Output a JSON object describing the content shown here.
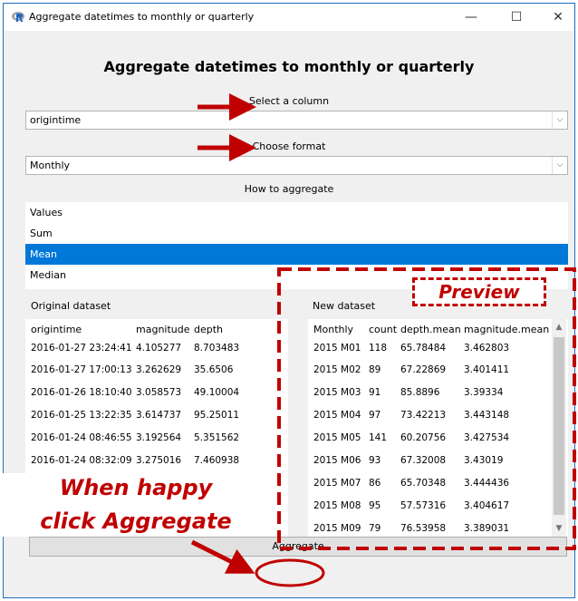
{
  "window": {
    "title": "Aggregate datetimes to monthly or quarterly",
    "min_symbol": "—",
    "max_symbol": "☐",
    "close_symbol": "✕"
  },
  "heading": "Aggregate datetimes to monthly or quarterly",
  "column_select": {
    "label": "Select a column",
    "value": "origintime"
  },
  "format_select": {
    "label": "Choose format",
    "value": "Monthly"
  },
  "aggregate_list": {
    "label": "How to aggregate",
    "items": [
      "Values",
      "Sum",
      "Mean",
      "Median"
    ],
    "selected": "Mean"
  },
  "original": {
    "title": "Original dataset",
    "columns": [
      "origintime",
      "magnitude",
      "depth"
    ],
    "rows": [
      [
        "2016-01-27 23:24:41",
        "4.105277",
        "8.703483"
      ],
      [
        "2016-01-27 17:00:13",
        "3.262629",
        "35.6506"
      ],
      [
        "2016-01-26 18:10:40",
        "3.058573",
        "49.10004"
      ],
      [
        "2016-01-25 13:22:35",
        "3.614737",
        "95.25011"
      ],
      [
        "2016-01-24 08:46:55",
        "3.192564",
        "5.351562"
      ],
      [
        "2016-01-24 08:32:09",
        "3.275016",
        "7.460938"
      ]
    ]
  },
  "new": {
    "title": "New dataset",
    "columns": [
      "Monthly",
      "count",
      "depth.mean",
      "magnitude.mean"
    ],
    "rows": [
      [
        "2015 M01",
        "118",
        "65.78484",
        "3.462803"
      ],
      [
        "2015 M02",
        "89",
        "67.22869",
        "3.401411"
      ],
      [
        "2015 M03",
        "91",
        "85.8896",
        "3.39334"
      ],
      [
        "2015 M04",
        "97",
        "73.42213",
        "3.443148"
      ],
      [
        "2015 M05",
        "141",
        "60.20756",
        "3.427534"
      ],
      [
        "2015 M06",
        "93",
        "67.32008",
        "3.43019"
      ],
      [
        "2015 M07",
        "86",
        "65.70348",
        "3.444436"
      ],
      [
        "2015 M08",
        "95",
        "57.57316",
        "3.404617"
      ],
      [
        "2015 M09",
        "79",
        "76.53958",
        "3.389031"
      ]
    ]
  },
  "aggregate_button": "Aggregate",
  "annotations": {
    "preview": "Preview",
    "line1": "When happy",
    "line2": "click Aggregate"
  },
  "colors": {
    "accent_red": "#c00000",
    "selection_blue": "#0078d7",
    "window_border": "#1f6fbf"
  }
}
